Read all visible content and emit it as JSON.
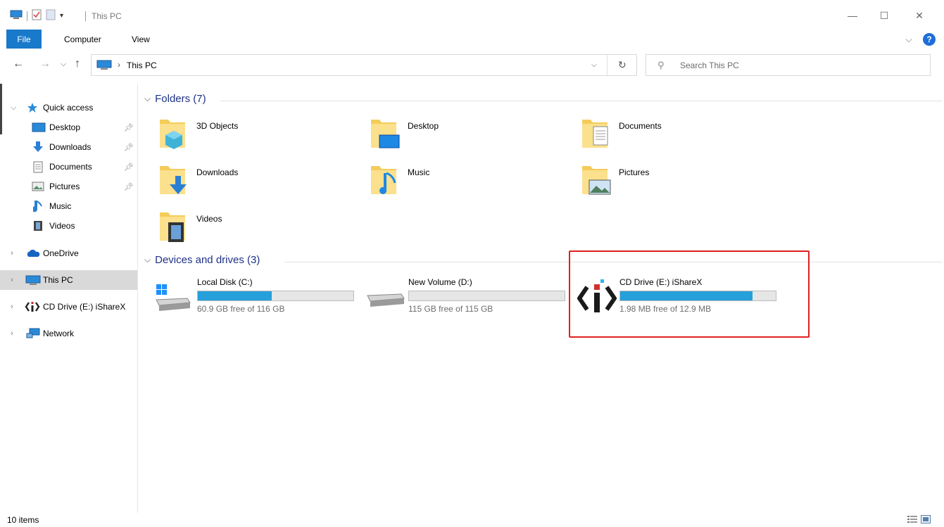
{
  "window": {
    "title": "This PC",
    "minimize_glyph": "—",
    "maximize_glyph": "☐",
    "close_glyph": "✕"
  },
  "ribbon": {
    "tabs": [
      {
        "label": "File"
      },
      {
        "label": "Computer"
      },
      {
        "label": "View"
      }
    ],
    "help_glyph": "?"
  },
  "address": {
    "path": "This PC",
    "search_placeholder": "Search This PC"
  },
  "sidebar": {
    "items": [
      {
        "label": "Quick access",
        "icon": "star-icon"
      },
      {
        "label": "Desktop",
        "icon": "desktop-icon",
        "pinned": true
      },
      {
        "label": "Downloads",
        "icon": "downloads-icon",
        "pinned": true
      },
      {
        "label": "Documents",
        "icon": "documents-icon",
        "pinned": true
      },
      {
        "label": "Pictures",
        "icon": "pictures-icon",
        "pinned": true
      },
      {
        "label": "Music",
        "icon": "music-icon"
      },
      {
        "label": "Videos",
        "icon": "videos-icon"
      },
      {
        "label": "OneDrive",
        "icon": "onedrive-icon"
      },
      {
        "label": "This PC",
        "icon": "this-pc-icon",
        "selected": true
      },
      {
        "label": "CD Drive (E:) iShareX",
        "icon": "isharex-icon"
      },
      {
        "label": "Network",
        "icon": "network-icon"
      }
    ]
  },
  "main": {
    "folders_header": "Folders (7)",
    "folders": [
      {
        "label": "3D Objects",
        "icon": "3d-objects-folder-icon"
      },
      {
        "label": "Desktop",
        "icon": "desktop-folder-icon"
      },
      {
        "label": "Documents",
        "icon": "documents-folder-icon"
      },
      {
        "label": "Downloads",
        "icon": "downloads-folder-icon"
      },
      {
        "label": "Music",
        "icon": "music-folder-icon"
      },
      {
        "label": "Pictures",
        "icon": "pictures-folder-icon"
      },
      {
        "label": "Videos",
        "icon": "videos-folder-icon"
      }
    ],
    "drives_header": "Devices and drives (3)",
    "drives": [
      {
        "label": "Local Disk (C:)",
        "free": "60.9 GB free of 116 GB",
        "used_fraction": 0.475,
        "icon": "windows-drive-icon"
      },
      {
        "label": "New Volume (D:)",
        "free": "115 GB free of 115 GB",
        "used_fraction": 0.0,
        "icon": "hard-drive-icon"
      },
      {
        "label": "CD Drive (E:) iShareX",
        "free": "1.98 MB free of 12.9 MB",
        "used_fraction": 0.85,
        "icon": "isharex-drive-icon"
      }
    ]
  },
  "status": {
    "items_count": "10 items"
  },
  "colors": {
    "accent": "#1979ca",
    "bar_fill": "#26a0da",
    "highlight": "#e02020",
    "header_text": "#1e3287"
  }
}
